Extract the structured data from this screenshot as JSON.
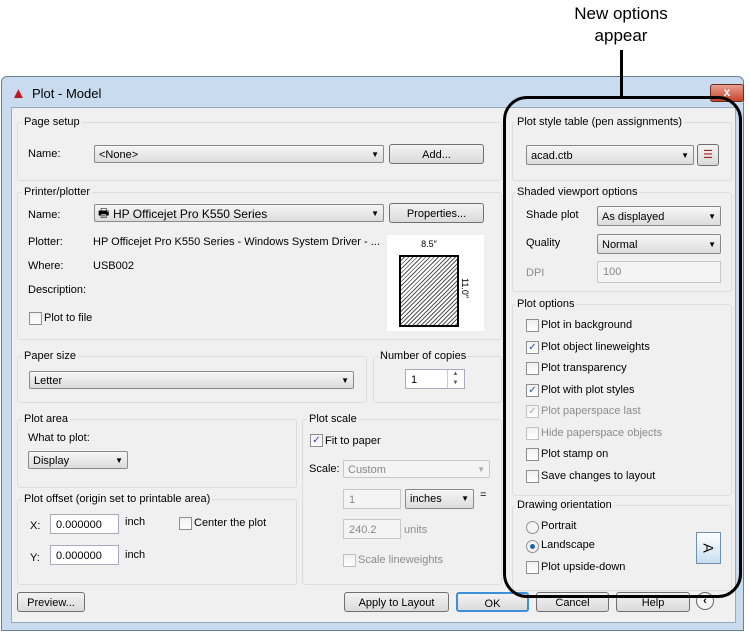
{
  "annotation": {
    "line1": "New options",
    "line2": "appear"
  },
  "window": {
    "title": "Plot - Model",
    "close": "x"
  },
  "page_setup": {
    "label": "Page setup",
    "name_label": "Name:",
    "name_value": "<None>",
    "add": "Add..."
  },
  "printer": {
    "label": "Printer/plotter",
    "name_label": "Name:",
    "name_value": "HP Officejet Pro K550 Series",
    "properties": "Properties...",
    "plotter_label": "Plotter:",
    "plotter_value": "HP Officejet Pro K550 Series - Windows System Driver - ...",
    "where_label": "Where:",
    "where_value": "USB002",
    "description_label": "Description:",
    "plot_to_file": "Plot to file",
    "plot_to_file_checked": false,
    "paper_width": "8.5″",
    "paper_height": "11.0″"
  },
  "paper_size": {
    "label": "Paper size",
    "value": "Letter"
  },
  "copies": {
    "label": "Number of copies",
    "value": "1"
  },
  "plot_area": {
    "label": "Plot area",
    "what_label": "What to plot:",
    "what_value": "Display"
  },
  "plot_offset": {
    "label": "Plot offset (origin set to printable area)",
    "x_label": "X:",
    "x_value": "0.000000",
    "x_unit": "inch",
    "y_label": "Y:",
    "y_value": "0.000000",
    "y_unit": "inch",
    "center": "Center the plot",
    "center_checked": false
  },
  "plot_scale": {
    "label": "Plot scale",
    "fit": "Fit to paper",
    "fit_checked": true,
    "scale_label": "Scale:",
    "scale_value": "Custom",
    "num": "1",
    "unit": "inches",
    "equals": "=",
    "units_value": "240.2",
    "units_label": "units",
    "scale_lw": "Scale lineweights"
  },
  "style_table": {
    "label": "Plot style table (pen assignments)",
    "value": "acad.ctb"
  },
  "shaded": {
    "label": "Shaded viewport options",
    "shade_label": "Shade plot",
    "shade_value": "As displayed",
    "quality_label": "Quality",
    "quality_value": "Normal",
    "dpi_label": "DPI",
    "dpi_value": "100"
  },
  "plot_options": {
    "label": "Plot options",
    "items": [
      {
        "label": "Plot in background",
        "checked": false,
        "enabled": true
      },
      {
        "label": "Plot object lineweights",
        "checked": true,
        "enabled": true
      },
      {
        "label": "Plot transparency",
        "checked": false,
        "enabled": true
      },
      {
        "label": "Plot with plot styles",
        "checked": true,
        "enabled": true
      },
      {
        "label": "Plot paperspace last",
        "checked": true,
        "enabled": false
      },
      {
        "label": "Hide paperspace objects",
        "checked": false,
        "enabled": false
      },
      {
        "label": "Plot stamp on",
        "checked": false,
        "enabled": true
      },
      {
        "label": "Save changes to layout",
        "checked": false,
        "enabled": true
      }
    ]
  },
  "orientation": {
    "label": "Drawing orientation",
    "portrait": "Portrait",
    "landscape": "Landscape",
    "selected": "Landscape",
    "upside": "Plot upside-down",
    "upside_checked": false,
    "icon_letter": "A"
  },
  "buttons": {
    "preview": "Preview...",
    "apply": "Apply to Layout",
    "ok": "OK",
    "cancel": "Cancel",
    "help": "Help"
  },
  "colors": {
    "accent": "#1d5fb0",
    "close": "#c8442c"
  }
}
